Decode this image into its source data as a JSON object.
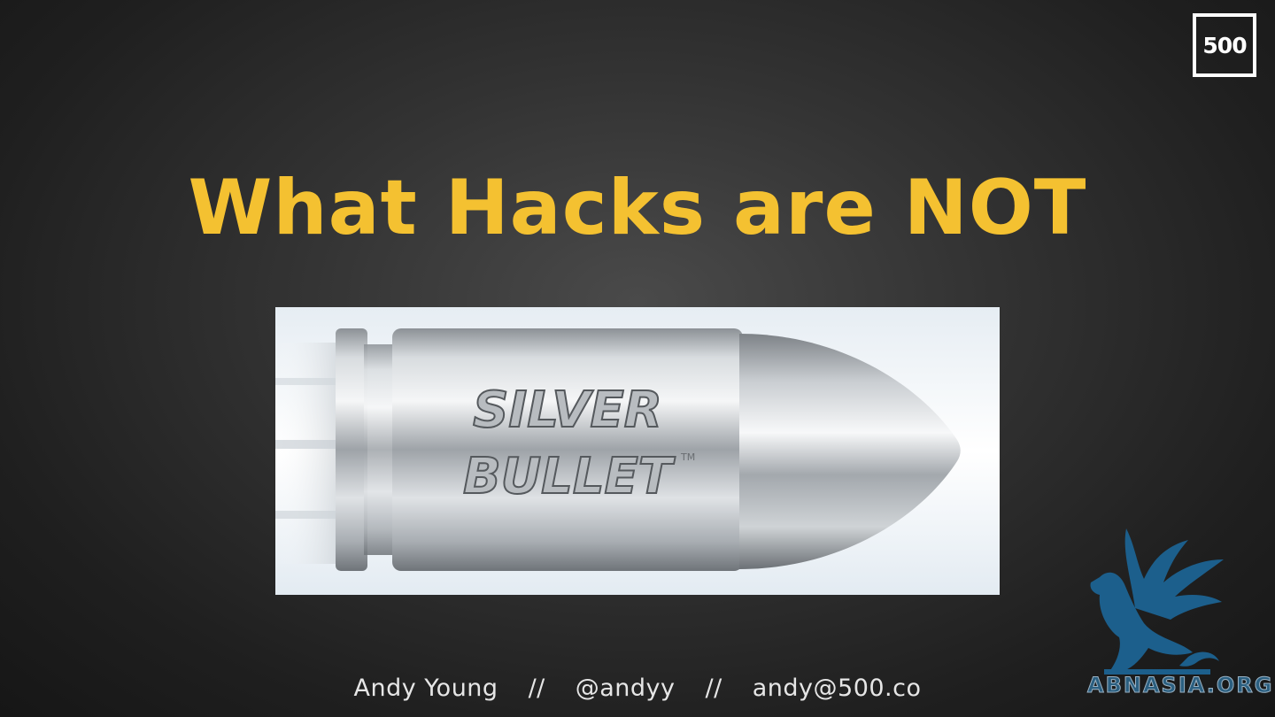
{
  "logo": {
    "text": "500"
  },
  "slide": {
    "title": "What Hacks are NOT"
  },
  "image": {
    "engraving_line1": "SILVER",
    "engraving_line2": "BULLET",
    "trademark": "TM"
  },
  "footer": {
    "name": "Andy Young",
    "separator": "//",
    "handle": "@andyy",
    "email": "andy@500.co"
  },
  "watermark": {
    "text": "ABNASIA.ORG",
    "icon": "griffin-icon"
  },
  "colors": {
    "title": "#f4c131",
    "background": "#2a2a2a",
    "footer_text": "#e6e6e6",
    "watermark": "#2b5f80"
  }
}
